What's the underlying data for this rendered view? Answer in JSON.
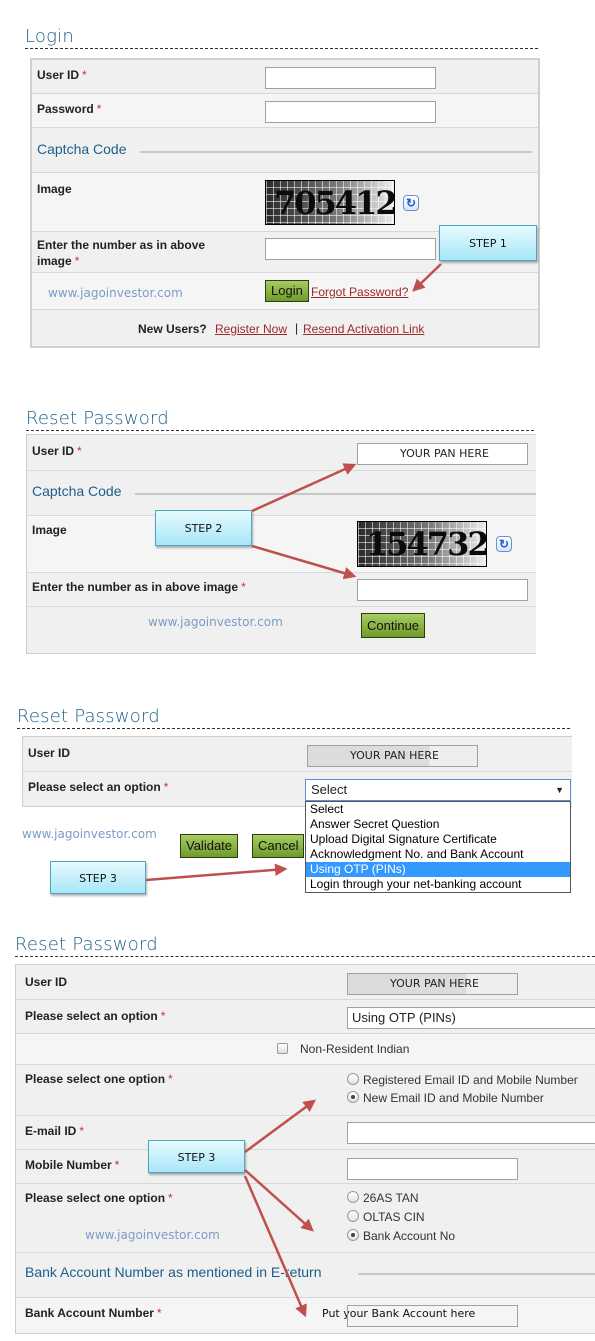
{
  "colors": {
    "heading": "#1d5f8a",
    "link": "#9b2a26",
    "button_green": "#8bb446",
    "arrow": "#c0504d",
    "step_fill": "#bdeefb",
    "highlight": "#3399ff"
  },
  "watermark": "www.jagoinvestor.com",
  "login": {
    "title": "Login",
    "user_id_label": "User ID",
    "password_label": "Password",
    "captcha_section": "Captcha Code",
    "image_label": "Image",
    "captcha_text": "705412",
    "refresh_icon": "refresh-icon",
    "enter_number_label_1": "Enter the number as in above",
    "enter_number_label_2": "image",
    "required": "*",
    "login_button": "Login",
    "forgot_link": "Forgot Password?",
    "new_users": "New Users?",
    "register_link": "Register Now",
    "separator": "|",
    "resend_link": "Resend Activation Link",
    "step_label": "STEP 1"
  },
  "reset1": {
    "title": "Reset Password",
    "user_id_label": "User ID",
    "user_id_value": "YOUR PAN HERE",
    "captcha_section": "Captcha Code",
    "image_label": "Image",
    "captcha_text": "154732",
    "enter_number_label": "Enter the number as in above image",
    "required": "*",
    "continue_button": "Continue",
    "step_label": "STEP 2"
  },
  "reset2": {
    "title": "Reset Password",
    "user_id_label": "User ID",
    "user_id_value": "YOUR PAN HERE",
    "option_label": "Please select an option",
    "required": "*",
    "select_value": "Select",
    "options": [
      "Select",
      "Answer Secret Question",
      "Upload Digital Signature Certificate",
      "Acknowledgment No. and Bank Account",
      "Using OTP (PINs)",
      "Login through your net-banking account"
    ],
    "selected_option_index": 4,
    "validate_button": "Validate",
    "cancel_button": "Cancel",
    "step_label": "STEP 3"
  },
  "reset3": {
    "title": "Reset Password",
    "user_id_label": "User ID",
    "user_id_value": "YOUR PAN HERE",
    "option_label": "Please select an option",
    "option_value": "Using OTP (PINs)",
    "required": "*",
    "nri_label": "Non-Resident Indian",
    "nri_checked": false,
    "one_option_label": "Please select one option",
    "contact_options": [
      {
        "label": "Registered Email ID and Mobile Number",
        "checked": false
      },
      {
        "label": "New Email ID and Mobile Number",
        "checked": true
      }
    ],
    "email_label": "E-mail ID",
    "mobile_label": "Mobile Number",
    "verify_option_label": "Please select one option",
    "verify_options": [
      {
        "label": "26AS TAN",
        "checked": false
      },
      {
        "label": "OLTAS CIN",
        "checked": false
      },
      {
        "label": "Bank Account No",
        "checked": true
      }
    ],
    "bank_section": "Bank Account Number as mentioned in E-return",
    "bank_label": "Bank Account Number",
    "bank_placeholder_note": "Put your Bank Account here",
    "step_label": "STEP 3"
  }
}
